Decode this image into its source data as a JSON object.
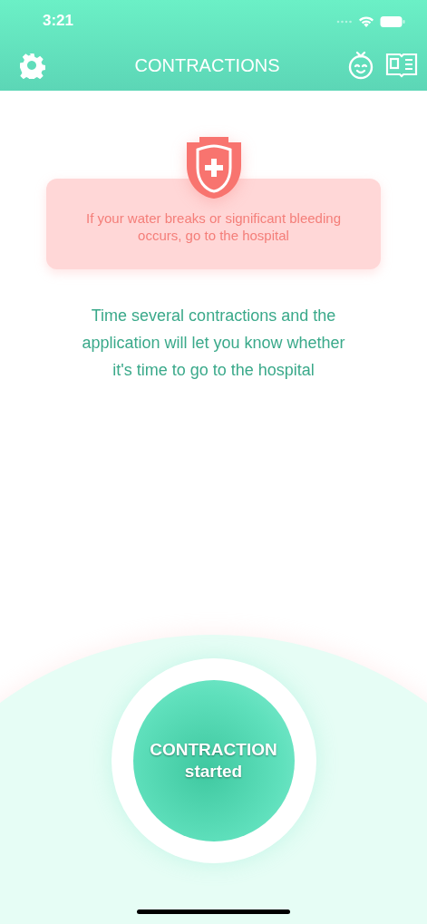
{
  "status_bar": {
    "time": "3:21"
  },
  "nav": {
    "title": "CONTRACTIONS"
  },
  "warning": {
    "text": "If your water breaks or significant bleeding occurs, go to the hospital"
  },
  "info": {
    "text": "Time several contractions and the application will let you know whether it's time to go to the hospital"
  },
  "contraction_button": {
    "title": "CONTRACTION",
    "subtitle": "started"
  }
}
